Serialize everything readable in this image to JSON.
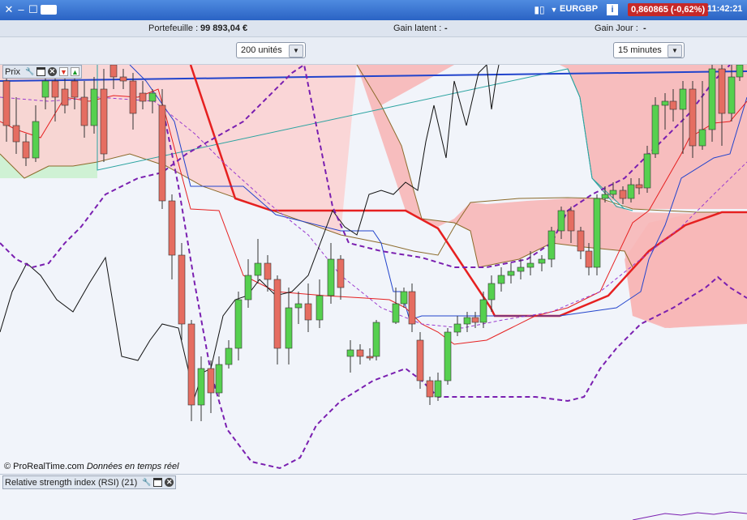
{
  "titlebar": {
    "instrument": "EURGBP",
    "info_icon": "i",
    "price": "0,860865 (-0,62%)",
    "time": "11:42:21",
    "icons": [
      "close-x-icon",
      "minimize-icon",
      "maximize-icon",
      "keyboard-icon",
      "candle-type-icon",
      "dropdown-arrow-icon",
      "info-icon"
    ]
  },
  "infobar": {
    "portfolio_label": "Portefeuille :",
    "portfolio_value": "99 893,04 €",
    "latent_label": "Gain latent :",
    "latent_value": "-",
    "day_label": "Gain Jour :",
    "day_value": "-"
  },
  "selectors": {
    "quantity": "200 unités",
    "timeframe": "15 minutes"
  },
  "price_panel": {
    "label": "Prix",
    "icons": [
      "wrench-icon",
      "window-icon",
      "close-circle-icon",
      "sell-red-icon",
      "buy-green-icon"
    ]
  },
  "credit": {
    "source": "© ProRealTime.com",
    "realtime": "Données en temps réel"
  },
  "rsi_panel": {
    "label": "Relative strength index (RSI) (21)",
    "icons": [
      "wrench-icon",
      "window-icon",
      "close-circle-icon"
    ]
  },
  "colors": {
    "title_bg": "#2a63c4",
    "up_candle": "#56d04f",
    "down_candle": "#e56d61",
    "price_badge": "#c62828",
    "kijun": "#e62020",
    "tenkan": "#2244cc",
    "chikou": "#111111",
    "bollinger": "#7a1fb0",
    "cloud_bear": "#f7b7b7",
    "cloud_bull": "#c9f0cc"
  }
}
